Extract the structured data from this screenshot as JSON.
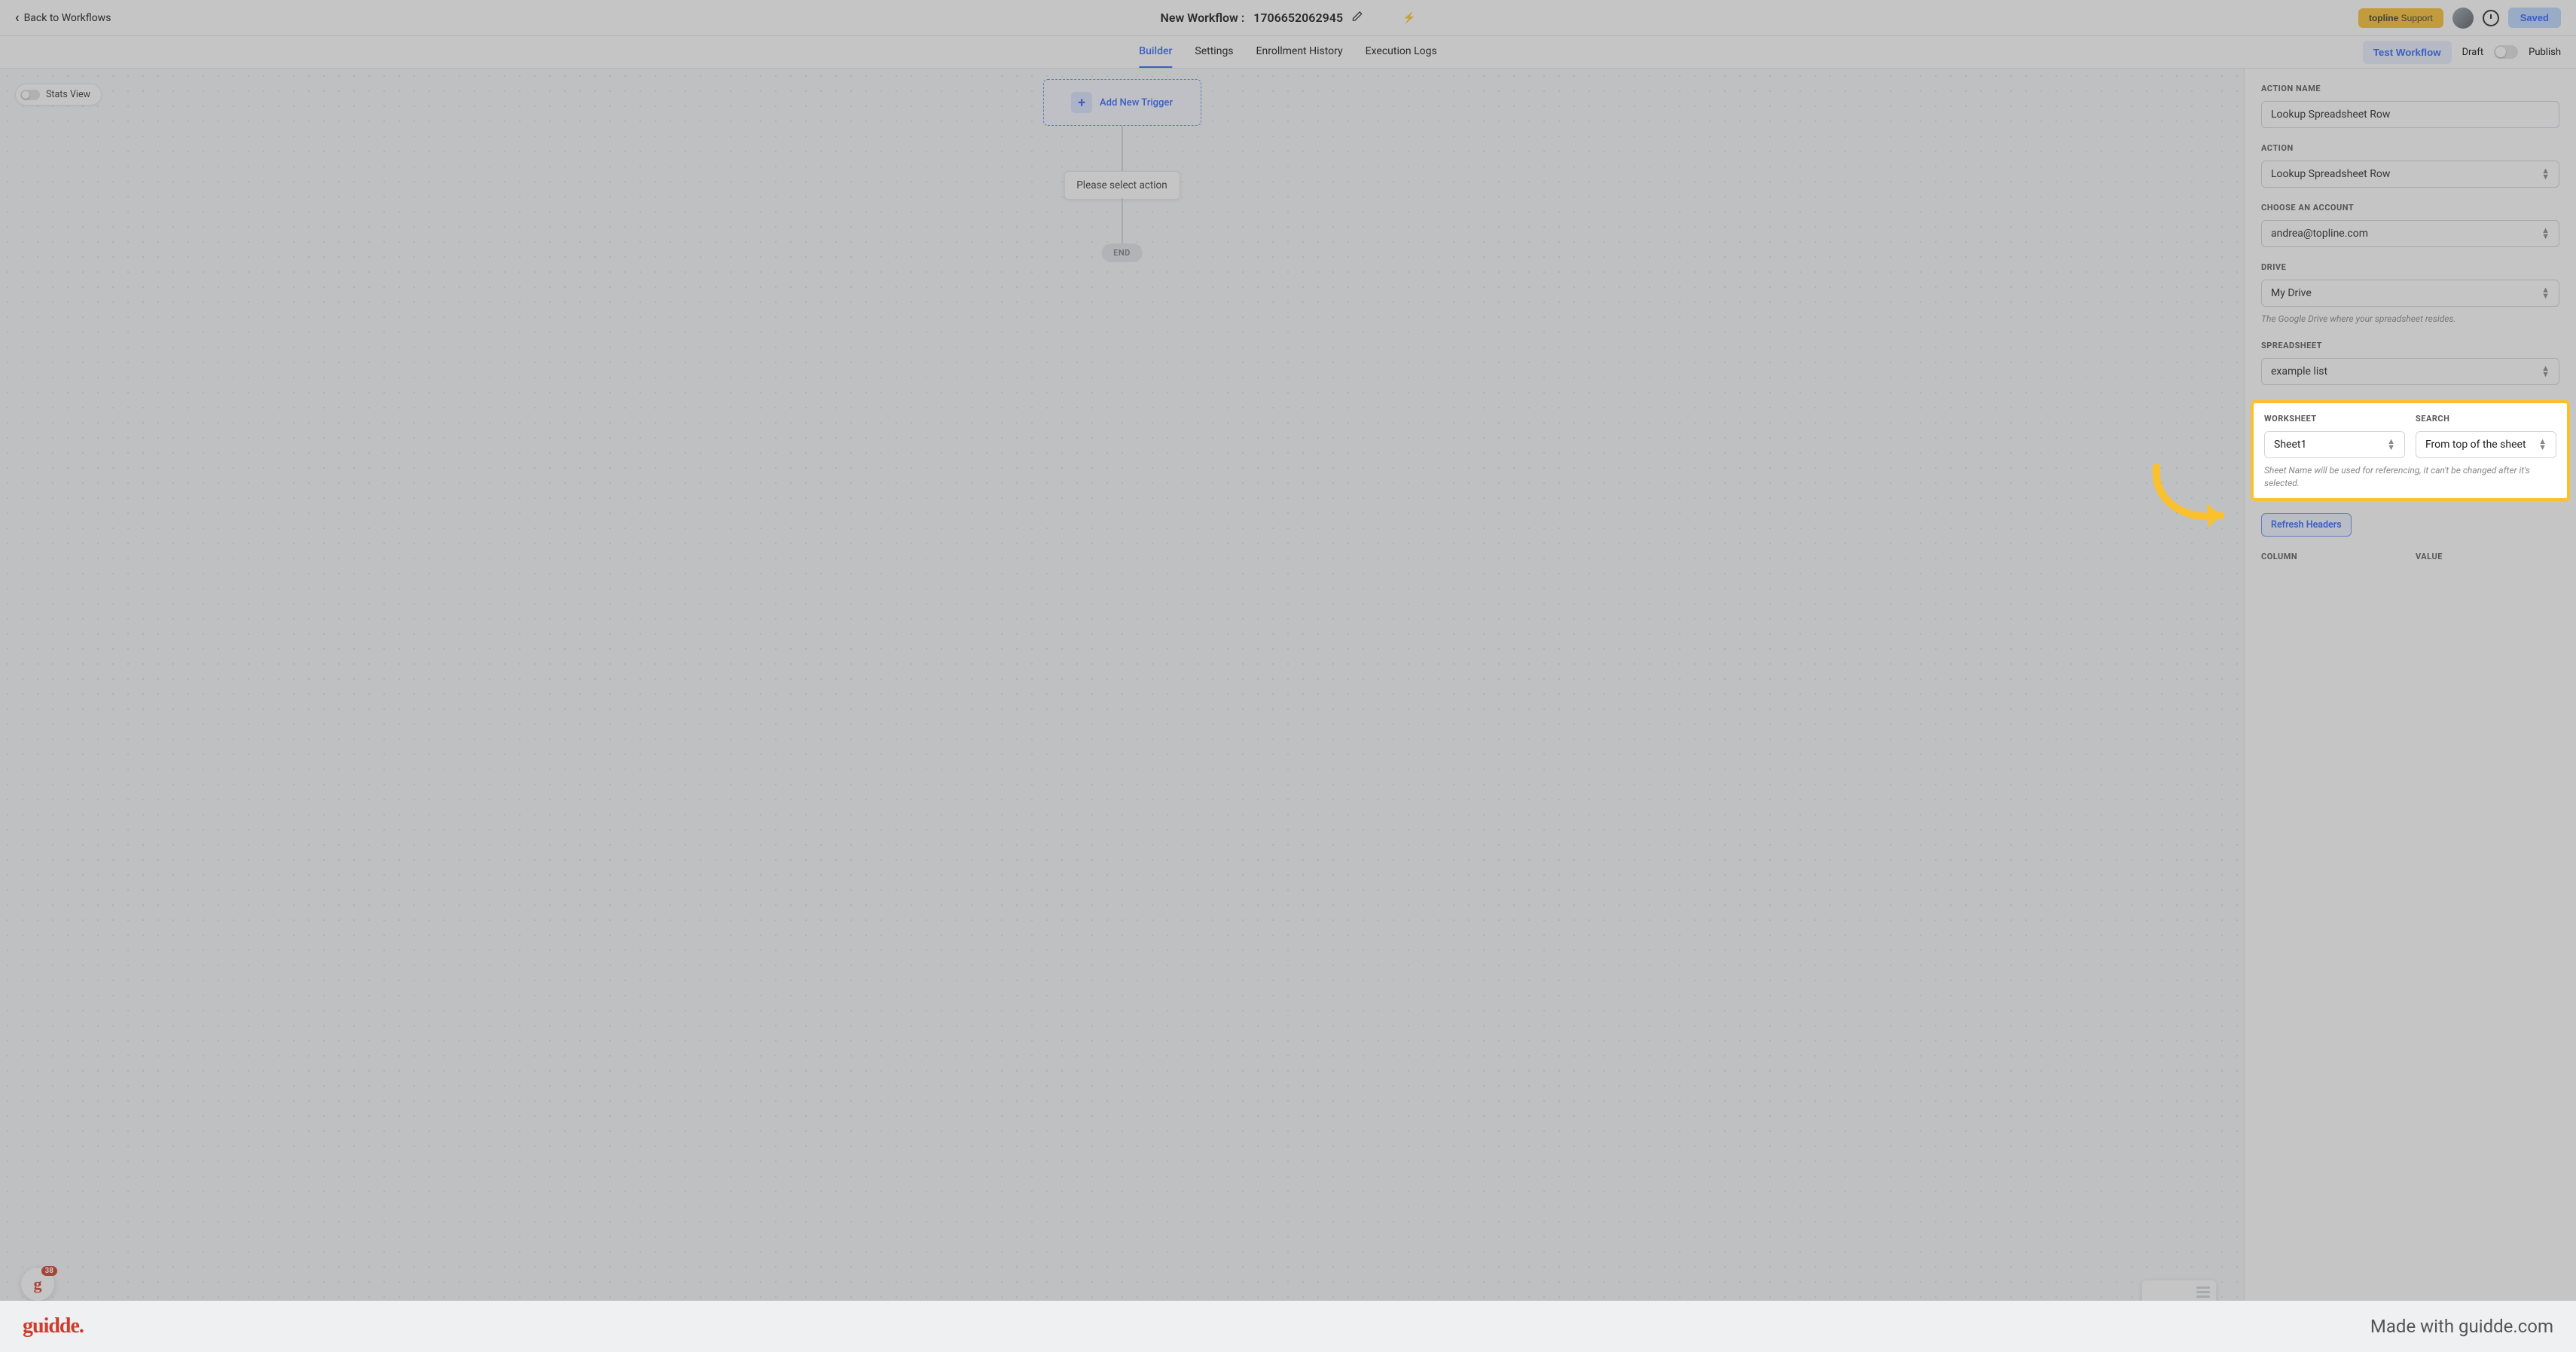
{
  "header": {
    "back_label": "Back to Workflows",
    "title_prefix": "New Workflow :",
    "title_id": "1706652062945",
    "support_brand": "topline",
    "support_label": "Support",
    "saved_label": "Saved"
  },
  "tabs": {
    "items": [
      "Builder",
      "Settings",
      "Enrollment History",
      "Execution Logs"
    ],
    "test_label": "Test Workflow",
    "draft_label": "Draft",
    "publish_label": "Publish"
  },
  "canvas": {
    "stats_label": "Stats View",
    "trigger_label": "Add New Trigger",
    "select_action_label": "Please select action",
    "end_label": "END",
    "bubble_count": "38"
  },
  "panel": {
    "action_name_label": "ACTION NAME",
    "action_name_value": "Lookup Spreadsheet Row",
    "action_label": "ACTION",
    "action_value": "Lookup Spreadsheet Row",
    "account_label": "CHOOSE AN ACCOUNT",
    "account_value": "andrea@topline.com",
    "drive_label": "DRIVE",
    "drive_value": "My Drive",
    "drive_hint": "The Google Drive where your spreadsheet resides.",
    "spreadsheet_label": "SPREADSHEET",
    "spreadsheet_value": "example list",
    "worksheet_label": "WORKSHEET",
    "worksheet_value": "Sheet1",
    "search_label": "SEARCH",
    "search_value": "From top of the sheet",
    "worksheet_hint": "Sheet Name will be used for referencing, it can't be changed after it's selected.",
    "refresh_label": "Refresh Headers",
    "column_label": "COLUMN",
    "value_label": "VALUE"
  },
  "footer": {
    "brand": "guidde.",
    "made_with": "Made with guidde.com"
  }
}
